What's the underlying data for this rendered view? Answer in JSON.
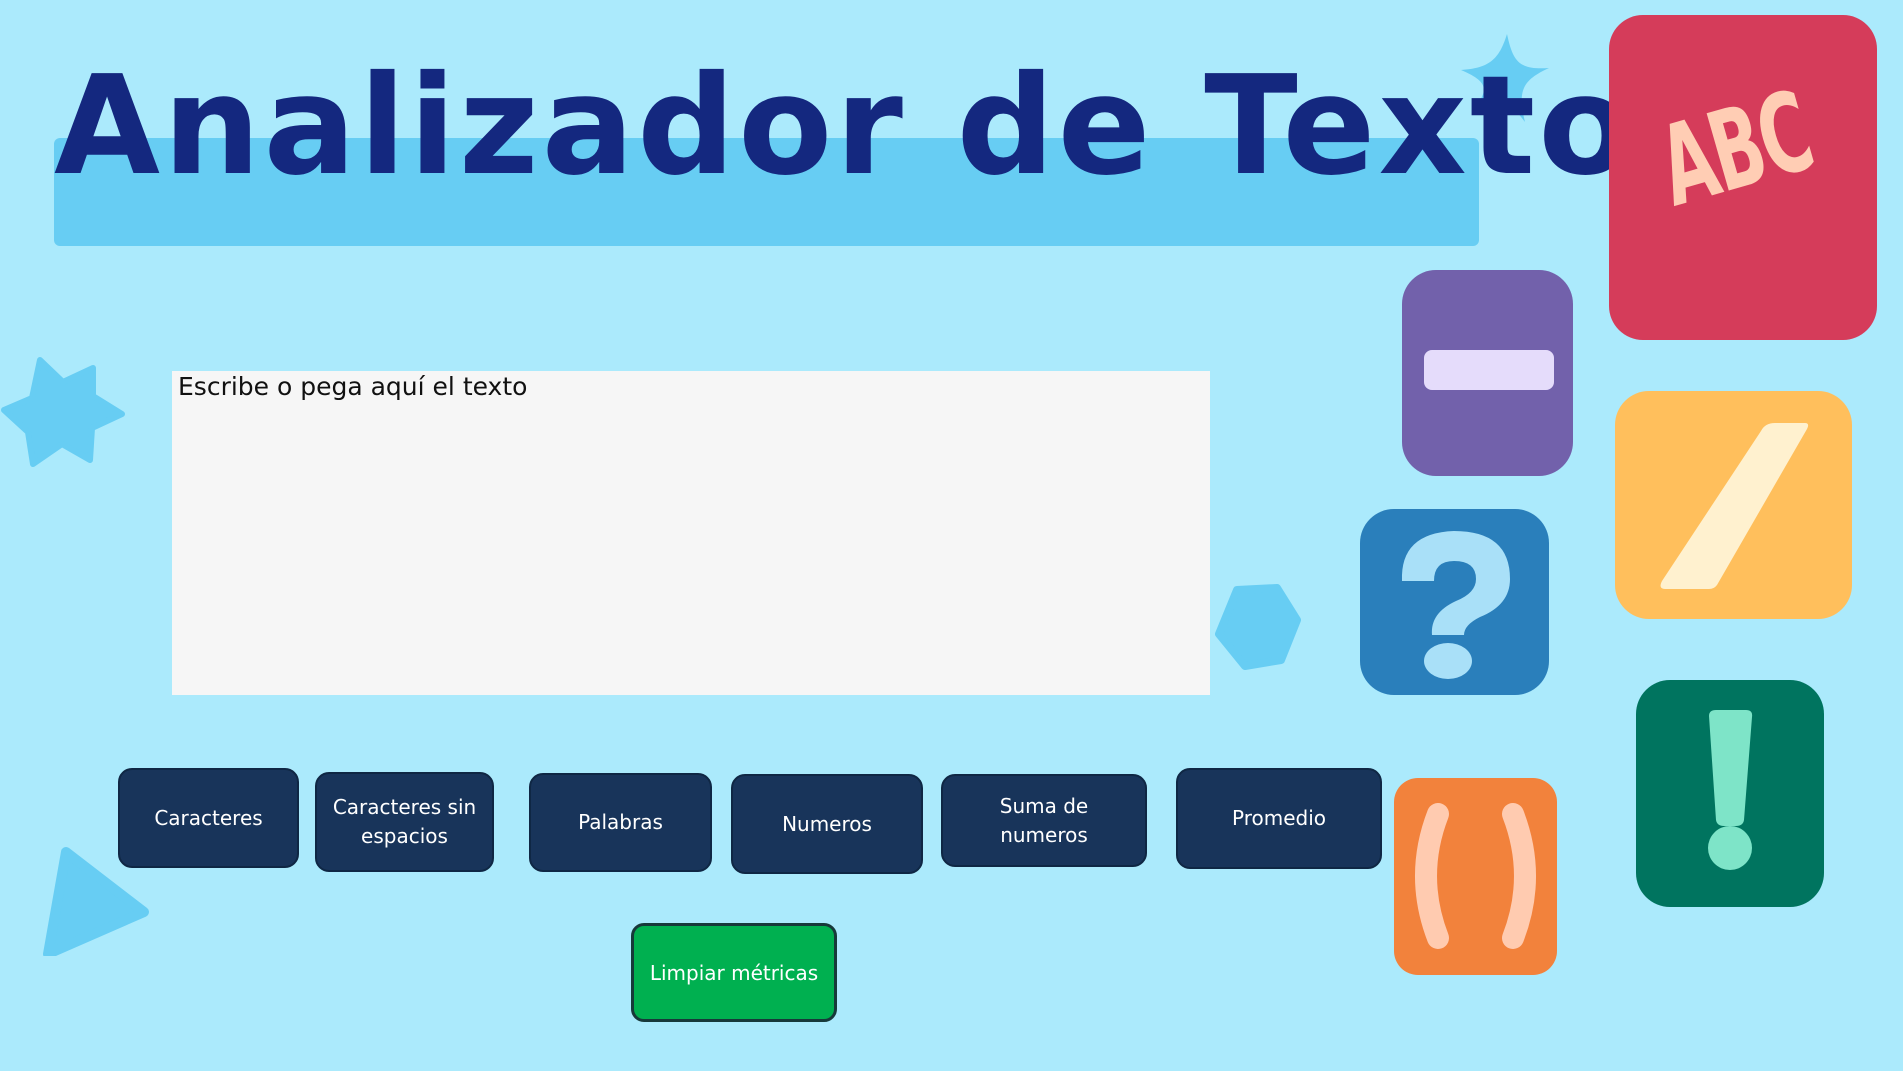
{
  "title": "Analizador de Texto",
  "input": {
    "placeholder": "Escribe o pega aquí el texto",
    "value": ""
  },
  "metrics": {
    "caracteres": "Caracteres",
    "caracteres_sin_espacios": "Caracteres sin espacios",
    "palabras": "Palabras",
    "numeros": "Numeros",
    "suma_numeros": "Suma de numeros",
    "promedio": "Promedio"
  },
  "clear_button": "Limpiar métricas",
  "decorations": {
    "abc_tile": {
      "text": "ABC",
      "color": "#d53c5a",
      "glyph_color": "#ffcdb4"
    },
    "minus_tile": {
      "icon": "minus-icon",
      "color": "#7261ab",
      "glyph_color": "#e5dcfb"
    },
    "slash_tile": {
      "icon": "slash-icon",
      "color": "#ffbf5c",
      "glyph_color": "#fff1cf"
    },
    "question_tile": {
      "icon": "question-mark-icon",
      "color": "#2a7fbb",
      "glyph_color": "#a9e0f8"
    },
    "exclamation_tile": {
      "icon": "exclamation-mark-icon",
      "color": "#00745f",
      "glyph_color": "#7ee4c8"
    },
    "parentheses_tile": {
      "icon": "parentheses-icon",
      "color": "#f2823c",
      "glyph_color": "#ffcbb0"
    }
  },
  "colors": {
    "background": "#abeafc",
    "title_text": "#14287f",
    "title_band": "#67cdf3",
    "metric_button": "#18345a",
    "clear_button": "#00b050",
    "decor_shape": "#67cdf3"
  }
}
